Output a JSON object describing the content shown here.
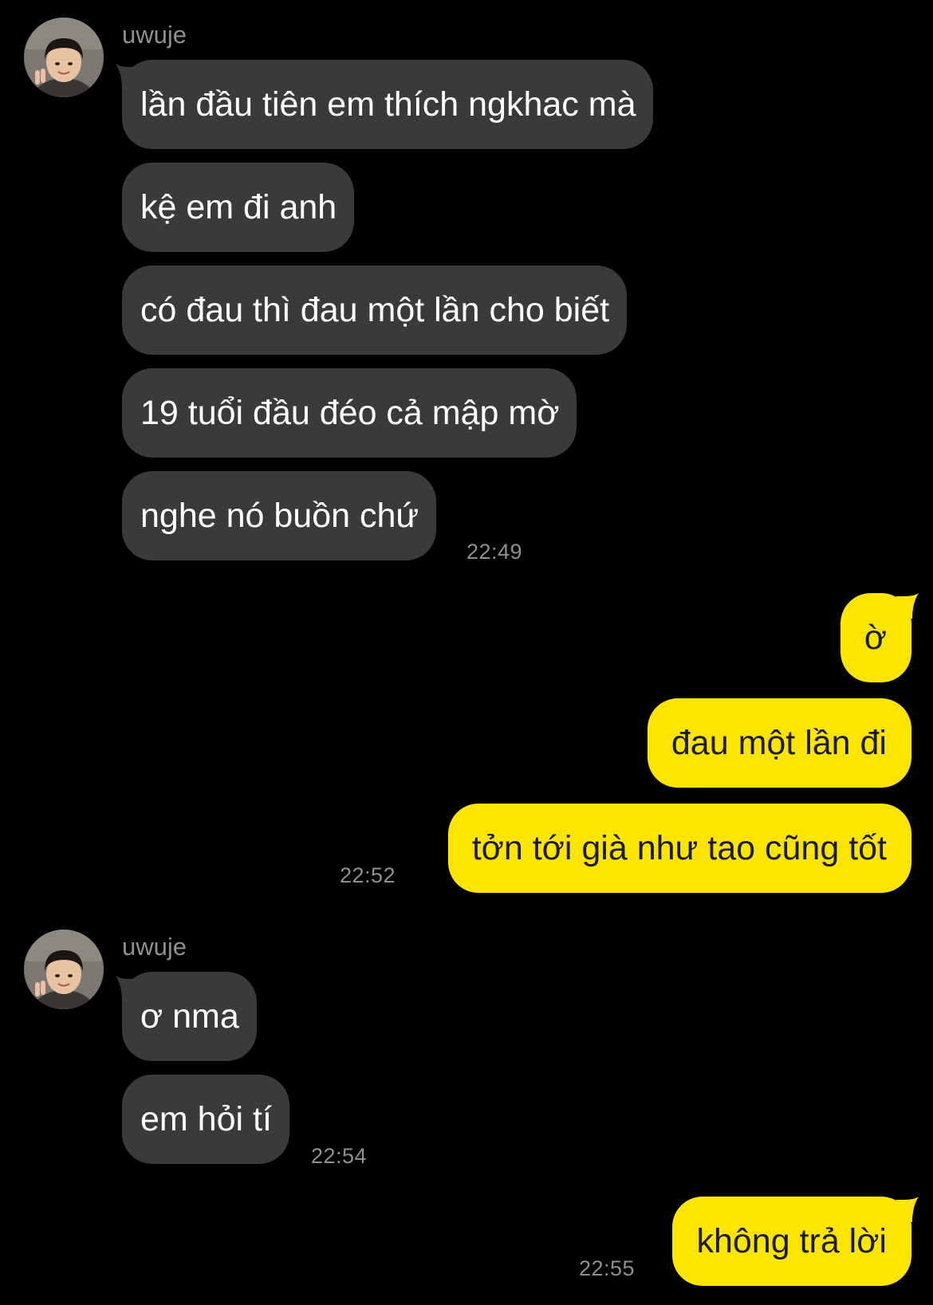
{
  "chat": {
    "colors": {
      "background": "#000000",
      "incoming_bubble": "#3a3a3c",
      "outgoing_bubble": "#fee500",
      "incoming_text": "#ffffff",
      "outgoing_text": "#1c1c1c",
      "meta_text": "#8e8e93"
    },
    "groups": [
      {
        "sender": "uwuje",
        "avatar_icon": "child-photo-avatar",
        "messages": [
          "lần đầu tiên em thích ngkhac mà",
          "kệ em đi anh",
          "có đau thì đau một lần cho biết",
          "19 tuổi đầu đéo cả mập mờ",
          "nghe nó buồn chứ"
        ],
        "time": "22:49"
      },
      {
        "sender": "me",
        "messages": [
          "ờ",
          "đau một lần đi",
          "tởn tới già như tao cũng tốt"
        ],
        "time": "22:52"
      },
      {
        "sender": "uwuje",
        "avatar_icon": "child-photo-avatar",
        "messages": [
          "ơ nma",
          "em hỏi tí"
        ],
        "time": "22:54"
      },
      {
        "sender": "me",
        "messages": [
          "không trả lời"
        ],
        "time": "22:55"
      }
    ]
  }
}
